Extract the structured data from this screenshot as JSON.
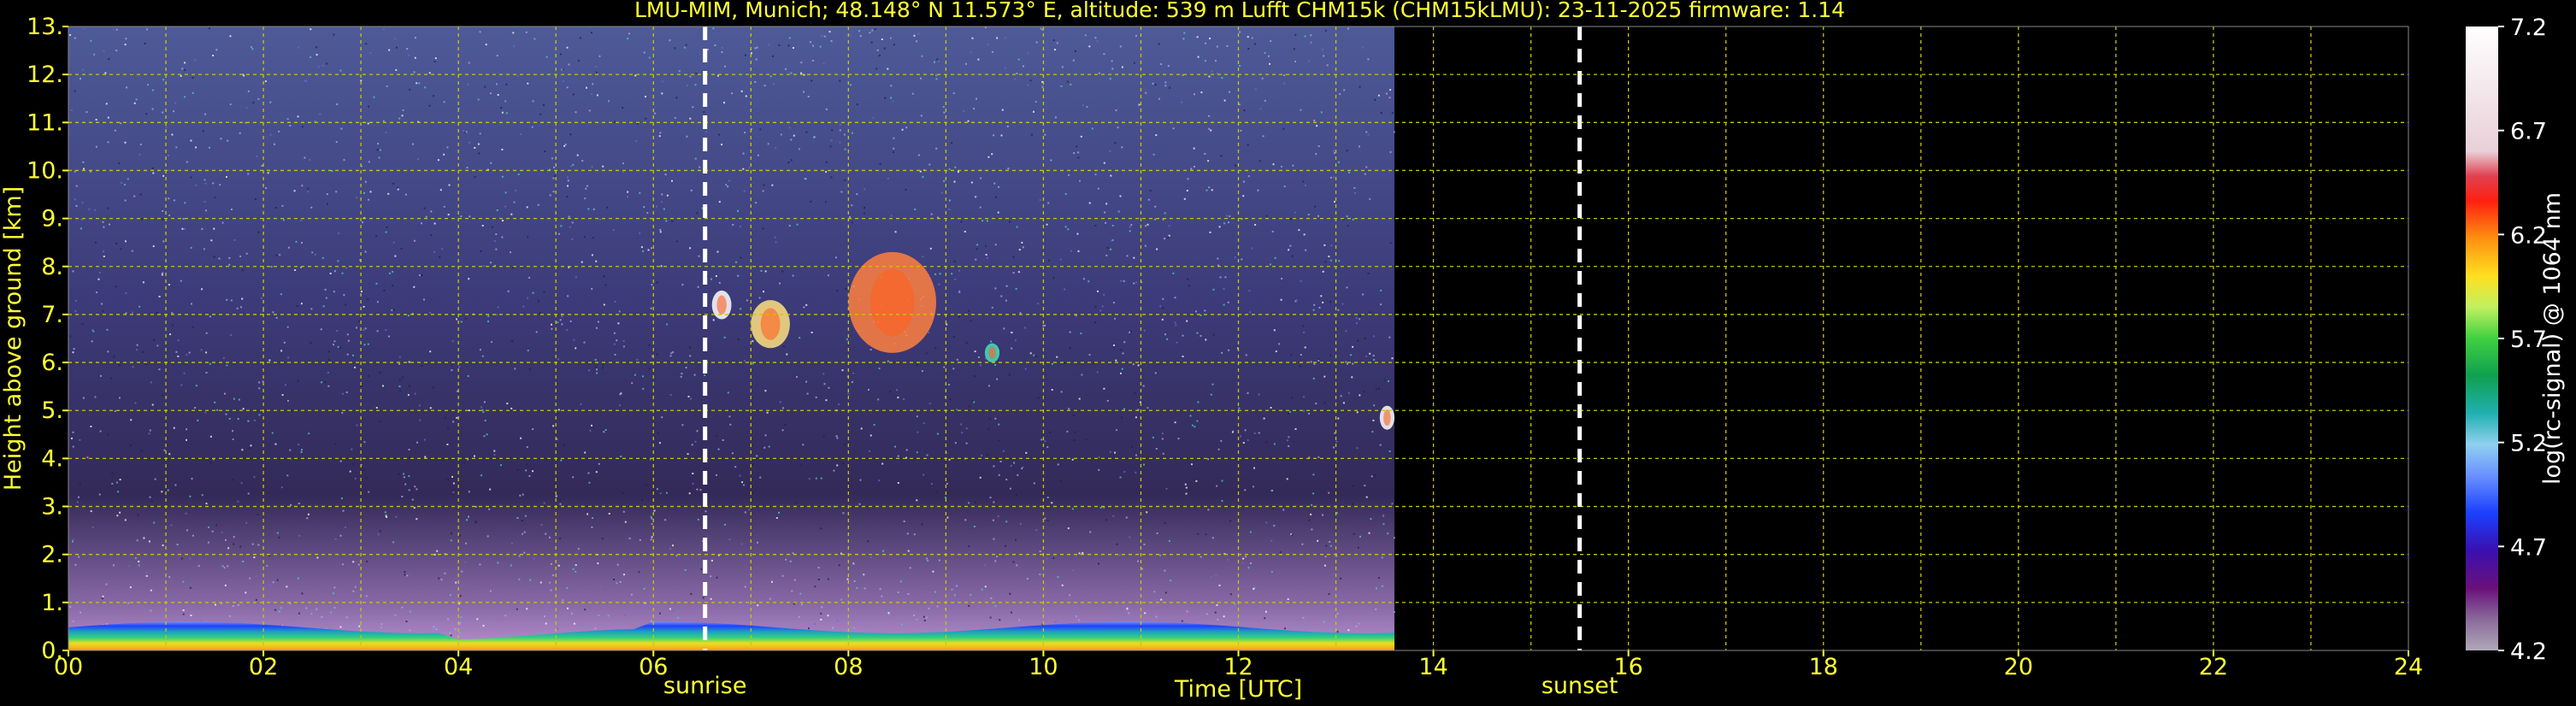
{
  "title": "LMU-MIM, Munich; 48.148° N 11.573° E, altitude: 539 m    Lufft CHM15k (CHM15kLMU): 23-11-2025    firmware: 1.14",
  "chart_data": {
    "type": "heatmap",
    "title": "LMU-MIM, Munich; 48.148° N 11.573° E, altitude: 539 m    Lufft CHM15k (CHM15kLMU): 23-11-2025    firmware: 1.14",
    "xlabel": "Time [UTC]",
    "ylabel": "Height above ground [km]",
    "xlim": [
      0,
      24
    ],
    "ylim": [
      0,
      13
    ],
    "x_ticks": [
      "00",
      "02",
      "04",
      "06",
      "08",
      "10",
      "12",
      "14",
      "16",
      "18",
      "20",
      "22",
      "24"
    ],
    "y_ticks": [
      "0.",
      "1.",
      "2.",
      "3.",
      "4.",
      "5.",
      "6.",
      "7.",
      "8.",
      "9.",
      "10.",
      "11.",
      "12.",
      "13."
    ],
    "grid": true,
    "data_end_hour": 13.6,
    "annotations": [
      {
        "label": "sunrise",
        "x": 6.53
      },
      {
        "label": "sunset",
        "x": 15.5
      }
    ],
    "colorbar": {
      "label": "log(rc-signal) @ 1064 nm",
      "range": [
        4.2,
        7.2
      ],
      "ticks": [
        "4.2",
        "4.7",
        "5.2",
        "5.7",
        "6.2",
        "6.7",
        "7.2"
      ]
    },
    "features": [
      {
        "name": "boundary layer",
        "x_start": 0,
        "x_end": 13.6,
        "height_km": [
          0,
          0.6
        ]
      },
      {
        "name": "cloud",
        "x_start": 6.6,
        "x_end": 6.8,
        "height_km": [
          6.9,
          7.5
        ]
      },
      {
        "name": "cloud",
        "x_start": 7.0,
        "x_end": 7.4,
        "height_km": [
          6.3,
          7.3
        ]
      },
      {
        "name": "cloud",
        "x_start": 8.0,
        "x_end": 8.9,
        "height_km": [
          6.2,
          8.3
        ]
      },
      {
        "name": "cloud",
        "x_start": 9.4,
        "x_end": 9.55,
        "height_km": [
          6.0,
          6.4
        ]
      },
      {
        "name": "cloud",
        "x_start": 13.45,
        "x_end": 13.6,
        "height_km": [
          4.6,
          5.1
        ]
      }
    ]
  },
  "colors": {
    "axis_text": "#ffff33",
    "grid": "#cccc00",
    "background": "#000000",
    "noise": "#3d3470",
    "boundary_layer": [
      "#5a78ff",
      "#1a3cff",
      "#20c0c0",
      "#30e080",
      "#e8e020",
      "#ff8020"
    ]
  }
}
